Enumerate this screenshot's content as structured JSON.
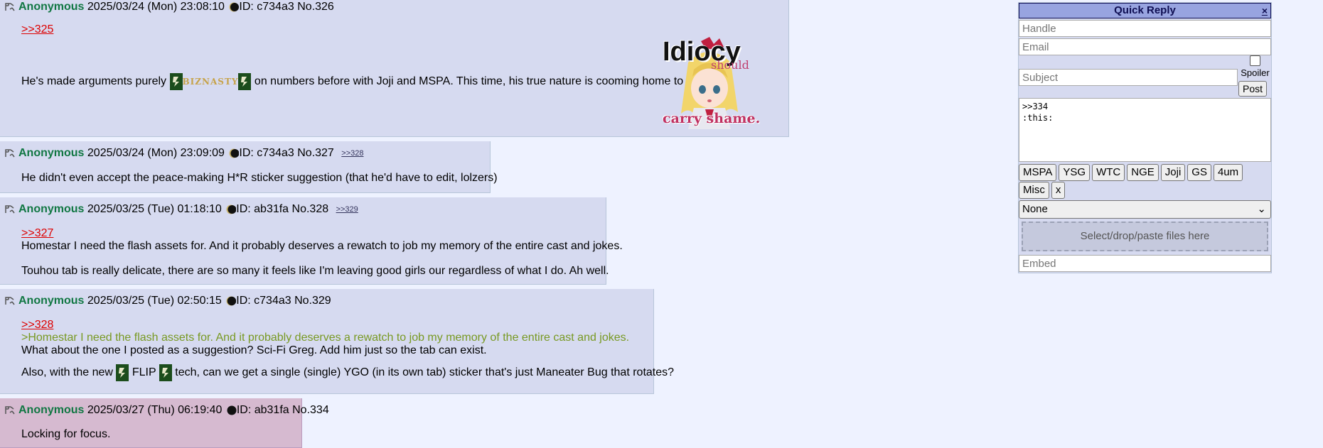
{
  "posts": [
    {
      "name": "Anonymous",
      "date": "2025/03/24 (Mon) 23:08:10",
      "id": "ID: c734a3",
      "no": "No.326",
      "quote": ">>325",
      "text_before": "He's made arguments purely",
      "biz": "BIZNASTY",
      "text_after": "on numbers before with Joji and MSPA. This time, his true nature is cooming home to roost.",
      "thumb": {
        "word1": "Idiocy",
        "word2": "should",
        "word3": "carry shame."
      }
    },
    {
      "name": "Anonymous",
      "date": "2025/03/24 (Mon) 23:09:09",
      "id": "ID: c734a3",
      "no": "No.327",
      "backlink": ">>328",
      "text": "He didn't even accept the peace-making H*R sticker suggestion (that he'd have to edit, lolzers)"
    },
    {
      "name": "Anonymous",
      "date": "2025/03/25 (Tue) 01:18:10",
      "id": "ID: ab31fa",
      "no": "No.328",
      "backlink": ">>329",
      "quote": ">>327",
      "line1": "Homestar I need the flash assets for. And it probably deserves a rewatch to job my memory of the entire cast and jokes.",
      "line2": "Touhou tab is really delicate, there are so many it feels like I'm leaving good girls our regardless of what I do. Ah well."
    },
    {
      "name": "Anonymous",
      "date": "2025/03/25 (Tue) 02:50:15",
      "id": "ID: c734a3",
      "no": "No.329",
      "quote": ">>328",
      "greentext": ">Homestar I need the flash assets for. And it probably deserves a rewatch to job my memory of the entire cast and jokes.",
      "line1": "What about the one I posted as a suggestion? Sci-Fi Greg. Add him just so the tab can exist.",
      "line2_before": "Also, with the new",
      "flip": "FLIP",
      "line2_after": "tech, can we get a single (single) YGO (in its own tab) sticker that's just Maneater Bug that rotates?"
    },
    {
      "name": "Anonymous",
      "date": "2025/03/27 (Thu) 06:19:40",
      "id": "ID: ab31fa",
      "no": "No.334",
      "text": "Locking for focus."
    }
  ],
  "quick_reply": {
    "title": "Quick Reply",
    "close": "×",
    "handle_placeholder": "Handle",
    "email_placeholder": "Email",
    "subject_placeholder": "Subject",
    "spoiler_label": "Spoiler",
    "post_label": "Post",
    "comment": ">>334\n:this:",
    "sticker_tabs": [
      "MSPA",
      "YSG",
      "WTC",
      "NGE",
      "Joji",
      "GS",
      "4um",
      "Misc",
      "x"
    ],
    "select_value": "None",
    "drop_text": "Select/drop/paste files here",
    "embed_placeholder": "Embed"
  },
  "colors": {
    "name": "#117743",
    "quotelink": "#dd0000",
    "greentext": "#789922",
    "post_bg": "#d6daf0",
    "highlight_bg": "#d6bad0"
  }
}
